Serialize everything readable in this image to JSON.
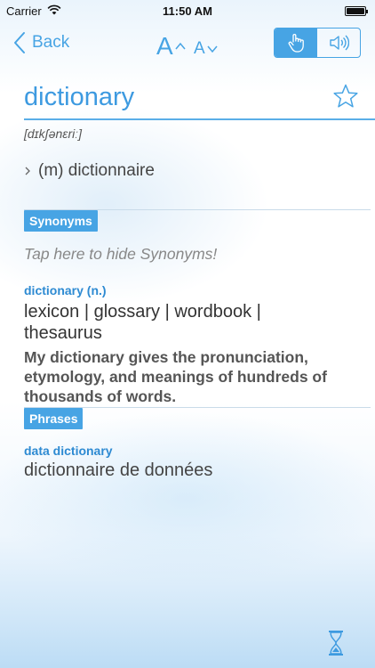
{
  "status_bar": {
    "carrier": "Carrier",
    "time": "11:50 AM",
    "battery_level": 1.0
  },
  "nav": {
    "back_label": "Back",
    "font_up_label": "A",
    "font_down_label": "A",
    "modes": [
      {
        "icon": "touch-hand-icon",
        "active": true
      },
      {
        "icon": "speaker-icon",
        "active": false
      }
    ]
  },
  "entry": {
    "headword": "dictionary",
    "pronunciation": "[dɪkʃənɛriː]",
    "translation": "(m) dictionnaire",
    "favorite": false
  },
  "synonyms": {
    "header": "Synonyms",
    "hint": "Tap here to hide Synonyms!",
    "sense": "dictionary (n.)",
    "list": "lexicon | glossary | wordbook | thesaurus",
    "example": "My dictionary gives the pronunciation, etymology, and meanings of hundreds of thousands of words."
  },
  "phrases": {
    "header": "Phrases",
    "items": [
      {
        "phrase": "data dictionary",
        "translation": "dictionnaire de données"
      }
    ]
  },
  "colors": {
    "accent": "#47a4e4",
    "headword": "#3d9ae0",
    "sense_label": "#2d8ad2"
  }
}
